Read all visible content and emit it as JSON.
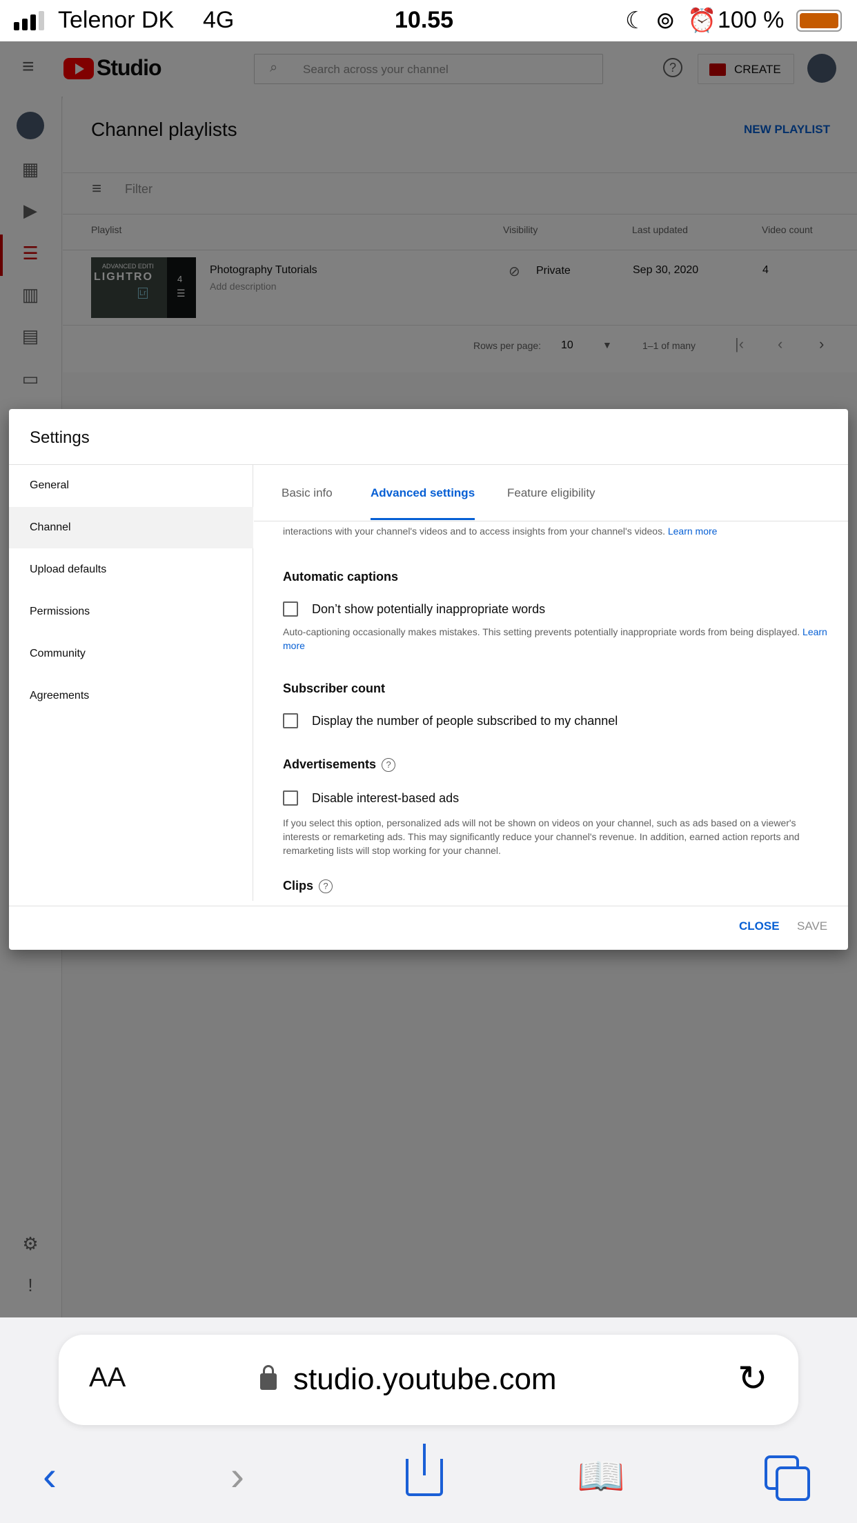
{
  "status_bar": {
    "carrier": "Telenor DK",
    "network": "4G",
    "time": "10.55",
    "battery": "100 %"
  },
  "app": {
    "logo": "Studio",
    "search_placeholder": "Search across your channel",
    "create_label": "CREATE"
  },
  "page": {
    "title": "Channel playlists",
    "new_playlist": "NEW PLAYLIST",
    "filter": "Filter",
    "columns": [
      "Playlist",
      "Visibility",
      "Last updated",
      "Video count"
    ],
    "rows": [
      {
        "title": "Photography Tutorials",
        "description": "Add description",
        "visibility": "Private",
        "updated": "Sep 30, 2020",
        "count": "4",
        "thumb_text": "ADVANCED EDITI",
        "thumb_big": "LIGHTRO",
        "thumb_badge": "Lr"
      }
    ],
    "pagination": {
      "rows_label": "Rows per page:",
      "rows_value": "10",
      "range": "1–1 of many"
    }
  },
  "dialog": {
    "title": "Settings",
    "nav": [
      "General",
      "Channel",
      "Upload defaults",
      "Permissions",
      "Community",
      "Agreements"
    ],
    "tabs": [
      "Basic info",
      "Advanced settings",
      "Feature eligibility"
    ],
    "intro_text": "interactions with your channel's videos and to access insights from your channel's videos.",
    "learn_more": "Learn more",
    "captions": {
      "heading": "Automatic captions",
      "checkbox": "Don’t show potentially inappropriate words",
      "help": "Auto-captioning occasionally makes mistakes. This setting prevents potentially inappropriate words from being displayed."
    },
    "subscribers": {
      "heading": "Subscriber count",
      "checkbox": "Display the number of people subscribed to my channel"
    },
    "ads": {
      "heading": "Advertisements",
      "checkbox": "Disable interest-based ads",
      "help": "If you select this option, personalized ads will not be shown on videos on your channel, such as ads based on a viewer's interests or remarketing ads. This may significantly reduce your channel's revenue. In addition, earned action reports and remarketing lists will stop working for your channel."
    },
    "clips": {
      "heading": "Clips"
    },
    "close": "CLOSE",
    "save": "SAVE"
  },
  "safari": {
    "text_size": "AA",
    "url": "studio.youtube.com"
  },
  "colors": {
    "accent": "#065fd4",
    "brand": "#ff0000",
    "battery": "#c55a00"
  }
}
